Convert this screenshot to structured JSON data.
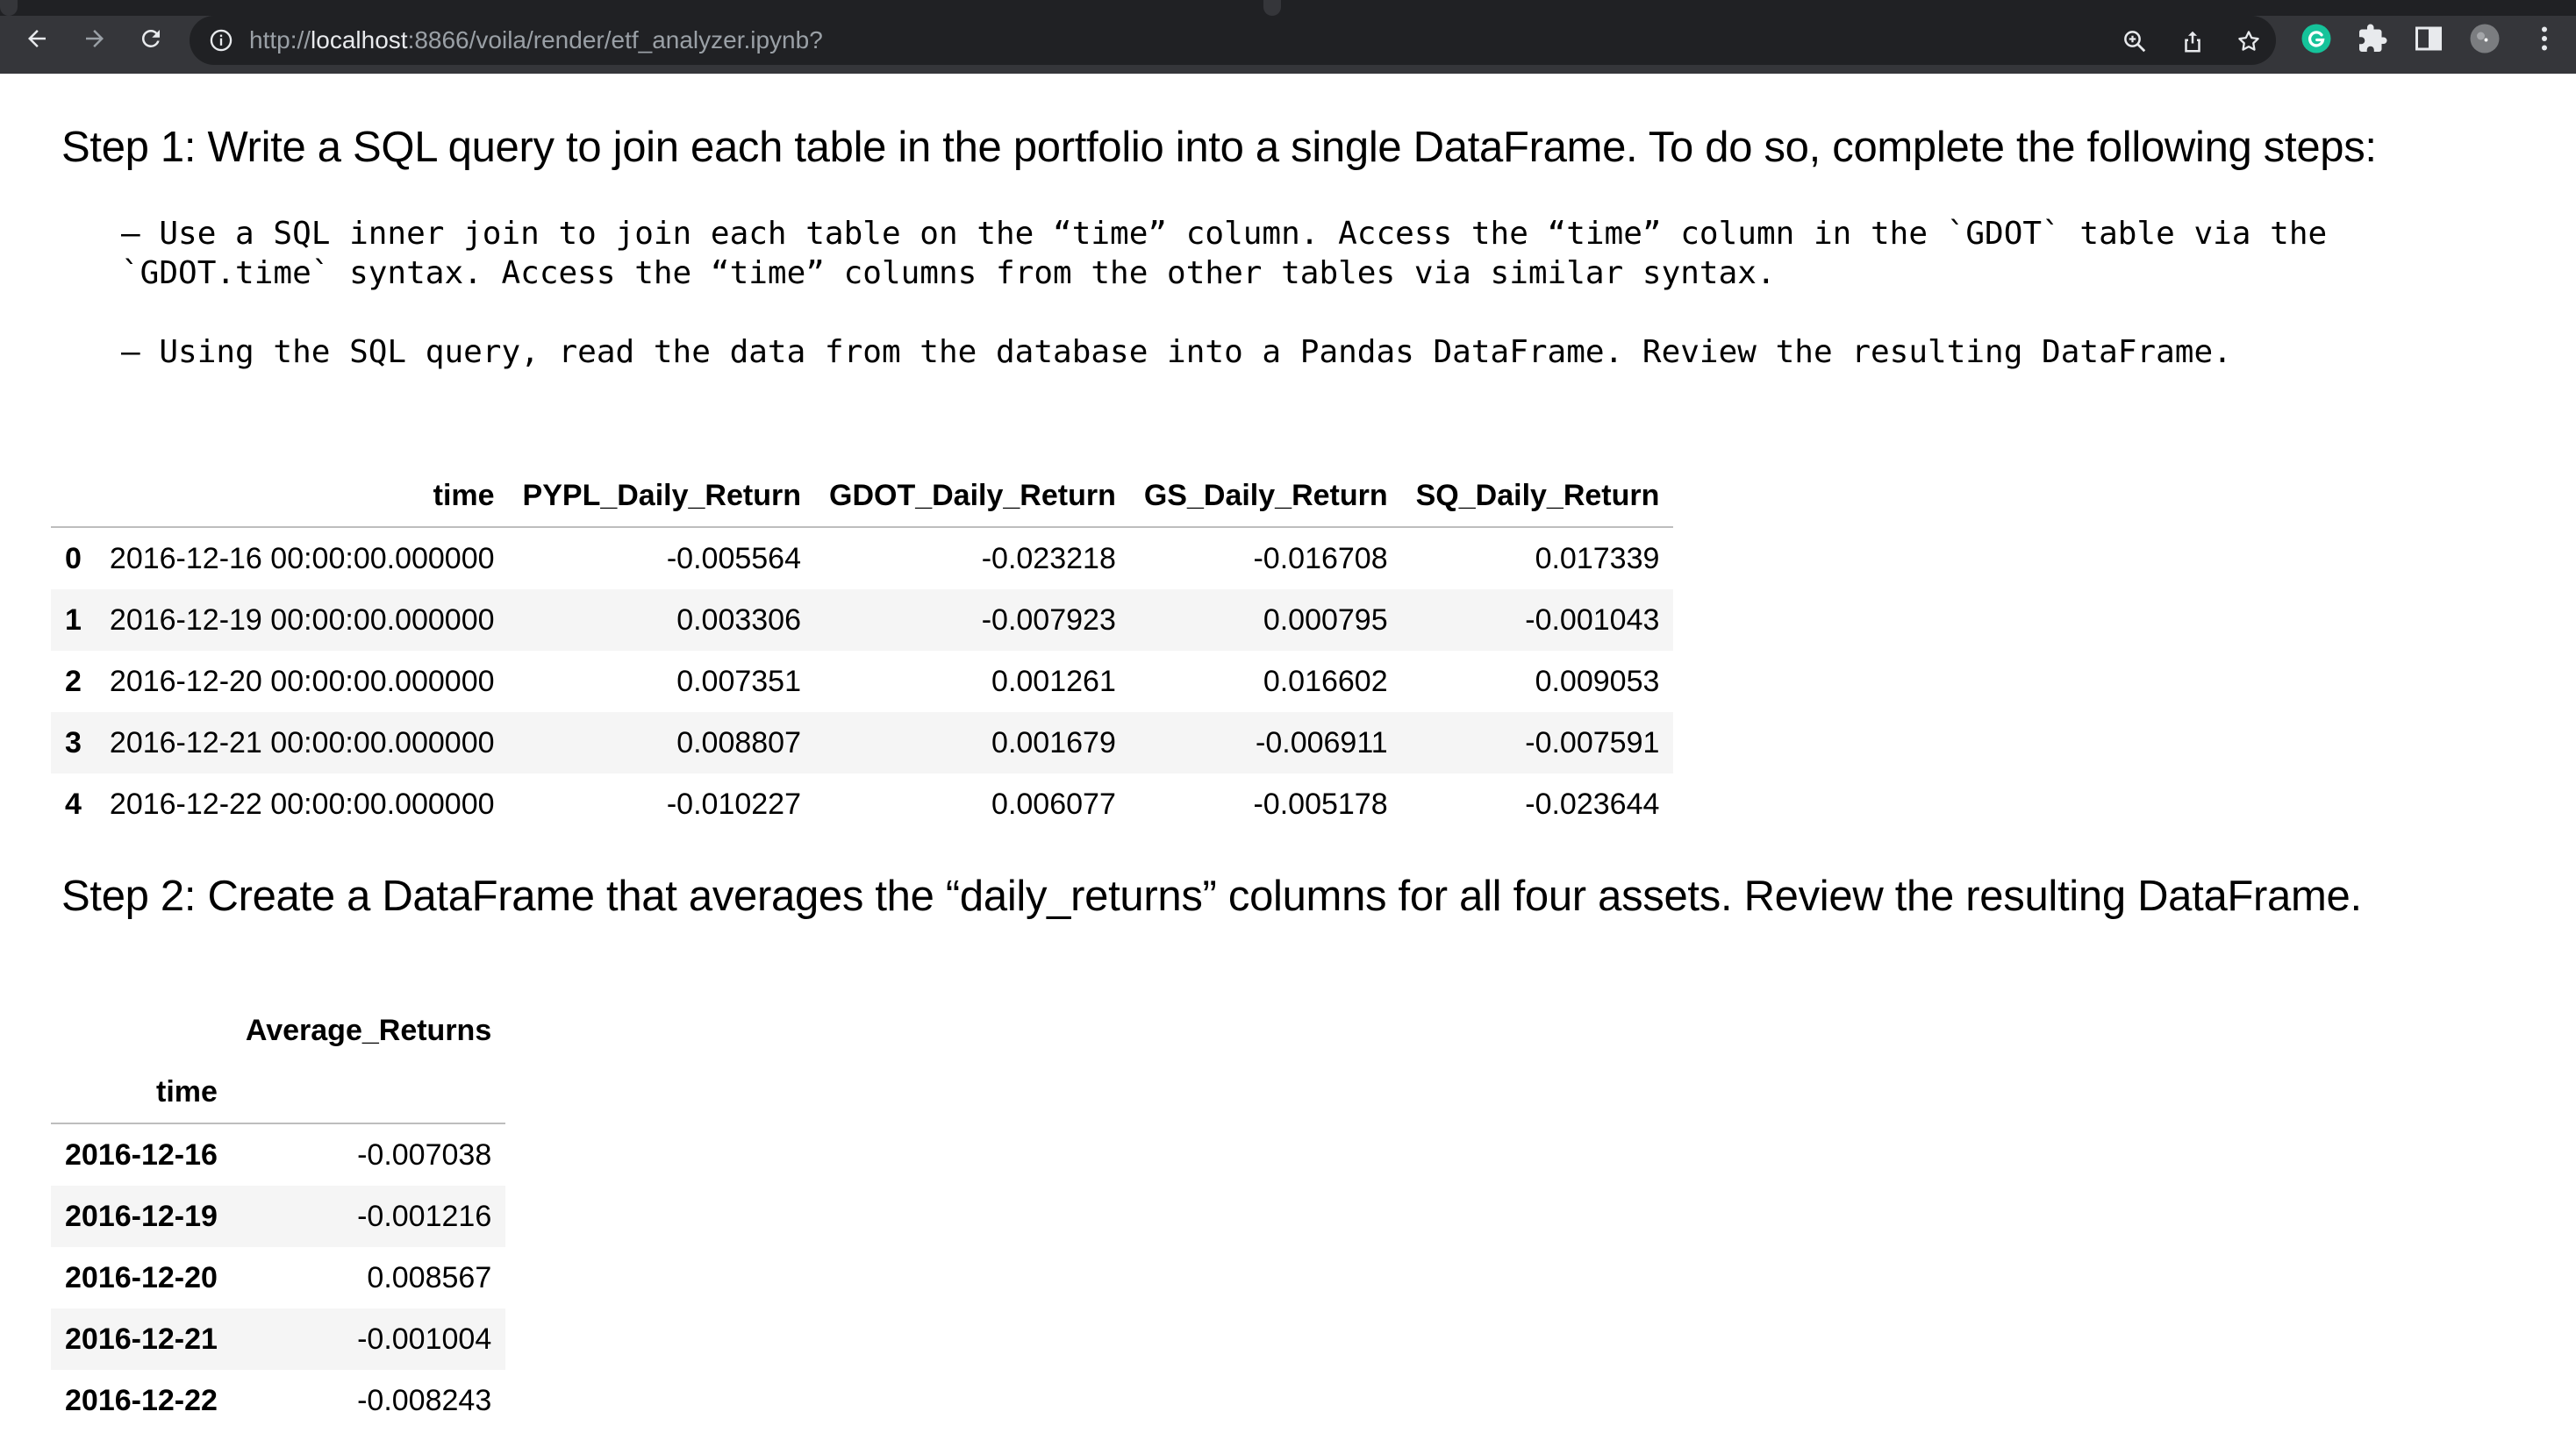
{
  "browser": {
    "url_prefix": "http://",
    "url_host": "localhost",
    "url_rest": ":8866/voila/render/etf_analyzer.ipynb?",
    "icons": [
      "back-icon",
      "forward-icon",
      "reload-icon",
      "info-icon",
      "zoom-icon",
      "share-icon",
      "bookmark-star-icon",
      "grammarly-icon",
      "extensions-icon",
      "side-panel-icon",
      "profile-avatar",
      "menu-icon"
    ]
  },
  "step1": {
    "heading": "Step 1: Write a SQL query to join each table in the portfolio into a single DataFrame. To do so, complete the following steps:",
    "bullet1_line1": "– Use a SQL inner join to join each table on the “time” column. Access the “time” column in the `GDOT` table via the",
    "bullet1_line2": "`GDOT.time` syntax. Access the “time” columns from the other tables via similar syntax.",
    "bullet2": "– Using the SQL query, read the data from the database into a Pandas DataFrame. Review the resulting DataFrame."
  },
  "joined_table": {
    "columns": [
      "",
      "time",
      "PYPL_Daily_Return",
      "GDOT_Daily_Return",
      "GS_Daily_Return",
      "SQ_Daily_Return"
    ],
    "rows": [
      {
        "index": "0",
        "time": "2016-12-16 00:00:00.000000",
        "pypl": "-0.005564",
        "gdot": "-0.023218",
        "gs": "-0.016708",
        "sq": "0.017339"
      },
      {
        "index": "1",
        "time": "2016-12-19 00:00:00.000000",
        "pypl": "0.003306",
        "gdot": "-0.007923",
        "gs": "0.000795",
        "sq": "-0.001043"
      },
      {
        "index": "2",
        "time": "2016-12-20 00:00:00.000000",
        "pypl": "0.007351",
        "gdot": "0.001261",
        "gs": "0.016602",
        "sq": "0.009053"
      },
      {
        "index": "3",
        "time": "2016-12-21 00:00:00.000000",
        "pypl": "0.008807",
        "gdot": "0.001679",
        "gs": "-0.006911",
        "sq": "-0.007591"
      },
      {
        "index": "4",
        "time": "2016-12-22 00:00:00.000000",
        "pypl": "-0.010227",
        "gdot": "0.006077",
        "gs": "-0.005178",
        "sq": "-0.023644"
      }
    ]
  },
  "step2": {
    "heading": "Step 2: Create a DataFrame that averages the “daily_returns” columns for all four assets. Review the resulting DataFrame."
  },
  "avg_table": {
    "column": "Average_Returns",
    "index_name": "time",
    "rows": [
      {
        "time": "2016-12-16",
        "value": "-0.007038"
      },
      {
        "time": "2016-12-19",
        "value": "-0.001216"
      },
      {
        "time": "2016-12-20",
        "value": "0.008567"
      },
      {
        "time": "2016-12-21",
        "value": "-0.001004"
      },
      {
        "time": "2016-12-22",
        "value": "-0.008243"
      }
    ]
  }
}
